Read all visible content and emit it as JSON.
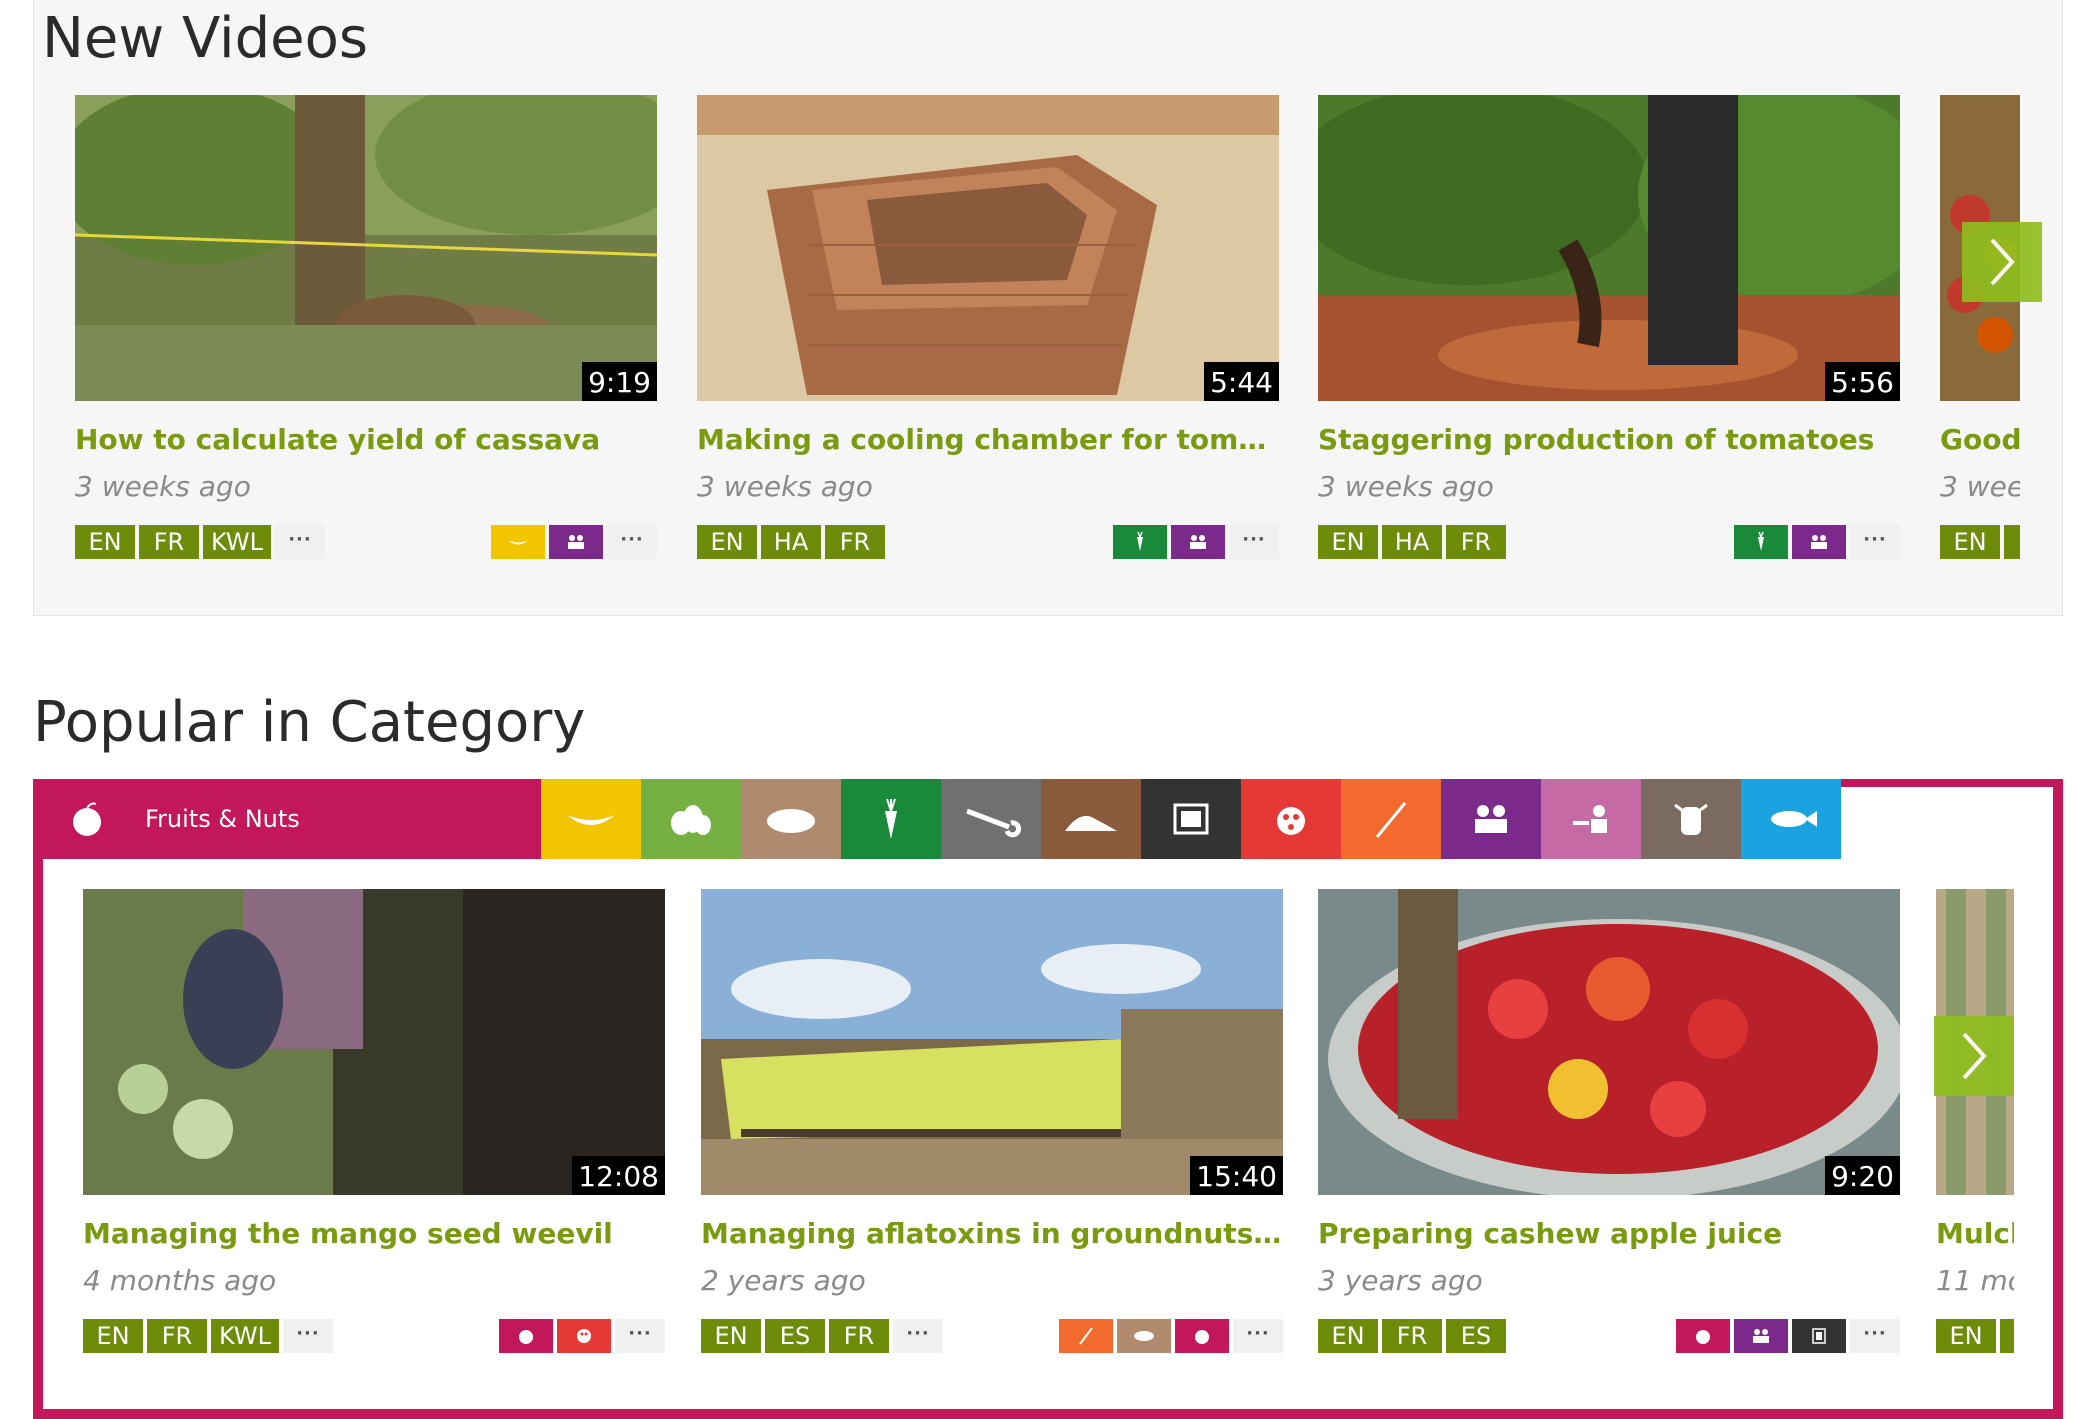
{
  "new_videos": {
    "title": "New Videos",
    "videos": [
      {
        "title": "How to calculate yield of cassava",
        "age": "3 weeks ago",
        "duration": "9:19",
        "languages": [
          "EN",
          "FR",
          "KWL"
        ],
        "categories": [
          {
            "icon": "banana-icon",
            "color": "#f2c500"
          },
          {
            "icon": "people-icon",
            "color": "#7b2a8c"
          }
        ]
      },
      {
        "title": "Making a cooling chamber for tomato…",
        "age": "3 weeks ago",
        "duration": "5:44",
        "languages": [
          "EN",
          "HA",
          "FR"
        ],
        "categories": [
          {
            "icon": "carrot-icon",
            "color": "#1a8a3a"
          },
          {
            "icon": "people-icon",
            "color": "#7b2a8c"
          }
        ]
      },
      {
        "title": "Staggering production of tomatoes",
        "age": "3 weeks ago",
        "duration": "5:56",
        "languages": [
          "EN",
          "HA",
          "FR"
        ],
        "categories": [
          {
            "icon": "carrot-icon",
            "color": "#1a8a3a"
          },
          {
            "icon": "people-icon",
            "color": "#7b2a8c"
          }
        ]
      },
      {
        "title": "Good",
        "age": "3 wee",
        "duration": "",
        "languages": [
          "EN",
          "I"
        ],
        "categories": []
      }
    ],
    "more_label": "···",
    "next_arrow_icon": "chevron-right-icon"
  },
  "popular": {
    "title": "Popular in Category",
    "active_category": {
      "label": "Fruits & Nuts",
      "icon": "apple-icon",
      "color": "#c2185b"
    },
    "category_tiles": [
      {
        "icon": "banana-icon",
        "color": "#f2c500"
      },
      {
        "icon": "garlic-icon",
        "color": "#76b043"
      },
      {
        "icon": "bean-icon",
        "color": "#b08a6e"
      },
      {
        "icon": "carrot-icon",
        "color": "#1a8a3a"
      },
      {
        "icon": "wrench-icon",
        "color": "#707070"
      },
      {
        "icon": "soil-icon",
        "color": "#8a5a3c"
      },
      {
        "icon": "film-icon",
        "color": "#333333"
      },
      {
        "icon": "ladybug-icon",
        "color": "#e53935"
      },
      {
        "icon": "wheat-icon",
        "color": "#f26a2e"
      },
      {
        "icon": "people-icon",
        "color": "#7b2a8c"
      },
      {
        "icon": "teacher-icon",
        "color": "#c66aa6"
      },
      {
        "icon": "cow-icon",
        "color": "#7a6a60"
      },
      {
        "icon": "fish-icon",
        "color": "#1aa3e0"
      }
    ],
    "videos": [
      {
        "title": "Managing the mango seed weevil",
        "age": "4 months ago",
        "duration": "12:08",
        "languages": [
          "EN",
          "FR",
          "KWL"
        ],
        "categories": [
          {
            "icon": "apple-icon",
            "color": "#c2185b"
          },
          {
            "icon": "ladybug-icon",
            "color": "#e53935"
          }
        ]
      },
      {
        "title": "Managing aflatoxins in groundnuts d…",
        "age": "2 years ago",
        "duration": "15:40",
        "languages": [
          "EN",
          "ES",
          "FR"
        ],
        "categories": [
          {
            "icon": "wheat-icon",
            "color": "#f26a2e"
          },
          {
            "icon": "bean-icon",
            "color": "#b08a6e"
          },
          {
            "icon": "apple-icon",
            "color": "#c2185b"
          }
        ]
      },
      {
        "title": "Preparing cashew apple juice",
        "age": "3 years ago",
        "duration": "9:20",
        "languages": [
          "EN",
          "FR",
          "ES"
        ],
        "categories": [
          {
            "icon": "apple-icon",
            "color": "#c2185b"
          },
          {
            "icon": "people-icon",
            "color": "#7b2a8c"
          },
          {
            "icon": "film-icon",
            "color": "#333333"
          }
        ]
      },
      {
        "title": "Mulcl",
        "age": "11 mo",
        "duration": "",
        "languages": [
          "EN",
          "I"
        ],
        "categories": []
      }
    ],
    "more_label": "···",
    "next_arrow_icon": "chevron-right-icon"
  },
  "colors": {
    "accent_green": "#7a9a10",
    "lang_green": "#6e8c0a",
    "arrow_green": "#8fbd1e",
    "magenta": "#c2185b"
  }
}
